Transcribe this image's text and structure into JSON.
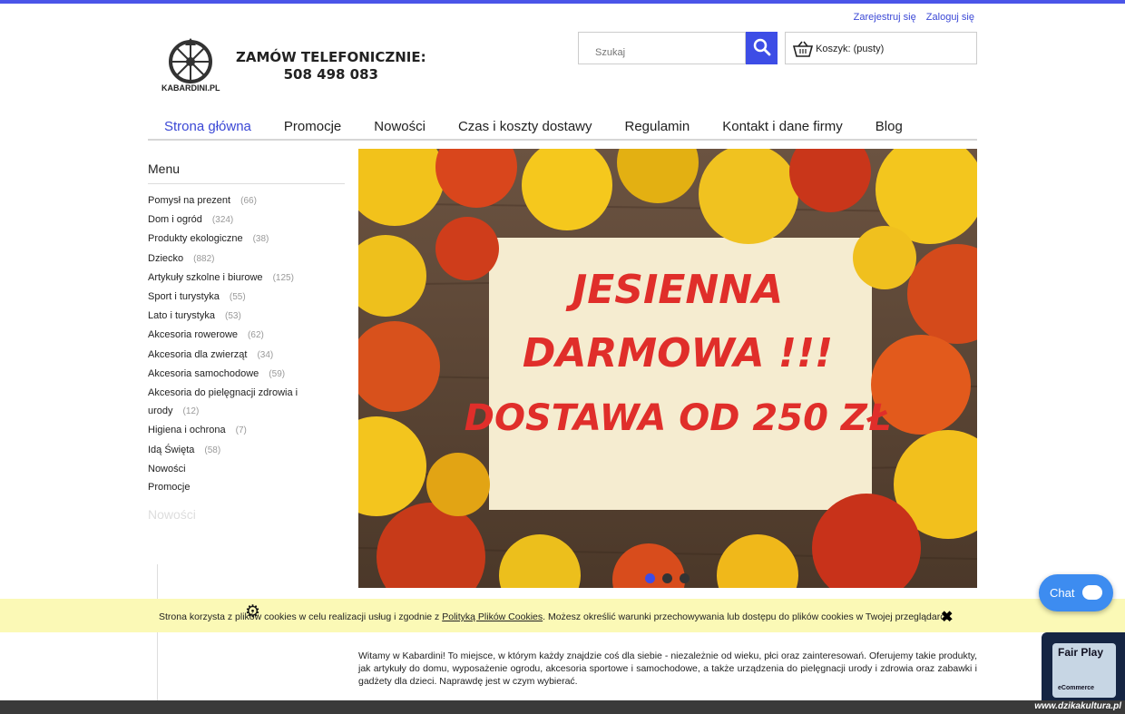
{
  "header": {
    "register_link": "Zarejestruj się",
    "login_link": "Zaloguj się",
    "logo_text": "KABARDINI.PL",
    "phone_label": "ZAMÓW TELEFONICZNIE:",
    "phone_number": "508 498 083",
    "search_placeholder": "Szukaj",
    "cart_label": "Koszyk: (pusty)",
    "accent_color": "#3d4de6"
  },
  "nav": {
    "items": [
      {
        "label": "Strona główna",
        "active": true
      },
      {
        "label": "Promocje"
      },
      {
        "label": "Nowości"
      },
      {
        "label": "Czas i koszty dostawy"
      },
      {
        "label": "Regulamin"
      },
      {
        "label": "Kontakt i dane firmy"
      },
      {
        "label": "Blog"
      }
    ]
  },
  "sidebar": {
    "menu_title": "Menu",
    "items": [
      {
        "label": "Pomysł na prezent",
        "count": "(66)"
      },
      {
        "label": "Dom i ogród",
        "count": "(324)"
      },
      {
        "label": "Produkty ekologiczne",
        "count": "(38)"
      },
      {
        "label": "Dziecko",
        "count": "(882)"
      },
      {
        "label": "Artykuły szkolne i biurowe",
        "count": "(125)"
      },
      {
        "label": "Sport i turystyka",
        "count": "(55)"
      },
      {
        "label": "Lato i turystyka",
        "count": "(53)"
      },
      {
        "label": "Akcesoria rowerowe",
        "count": "(62)"
      },
      {
        "label": "Akcesoria dla zwierząt",
        "count": "(34)"
      },
      {
        "label": "Akcesoria samochodowe",
        "count": "(59)"
      },
      {
        "label": "Akcesoria do pielęgnacji zdrowia i",
        "count": ""
      },
      {
        "label": "urody",
        "count": "(12)"
      },
      {
        "label": "Higiena i ochrona",
        "count": "(7)"
      },
      {
        "label": "Idą Święta",
        "count": "(58)"
      },
      {
        "label": "Nowości",
        "count": ""
      },
      {
        "label": "Promocje",
        "count": ""
      }
    ],
    "new_title": "Nowości"
  },
  "banner": {
    "line1": "JESIENNA",
    "line2": "DARMOWA !!!",
    "line3": "DOSTAWA OD 250 ZŁ",
    "text_color": "#e02e2a",
    "slides": 3,
    "active_slide": 1
  },
  "cookie": {
    "text_before": "Strona korzysta z plików cookies w celu realizacji usług i zgodnie z ",
    "link": "Polityką Plików Cookies",
    "text_after": ". Możesz określić warunki przechowywania lub dostępu do plików cookies w Twojej przeglądarce.",
    "close_icon": "✖"
  },
  "intro": {
    "text": "Witamy w Kabardini! To miejsce, w którym każdy znajdzie coś dla siebie - niezależnie od wieku, płci oraz zainteresowań. Oferujemy takie produkty, jak artykuły do domu, wyposażenie ogrodu, akcesoria sportowe i samochodowe, a także urządzenia do pielęgnacji urody i zdrowia oraz zabawki i gadżety dla dzieci. Naprawdę jest w czym wybierać."
  },
  "widgets": {
    "chat_label": "Chat",
    "fairplay_title": "Fair Play",
    "fairplay_sub": "eCommerce",
    "watermark": "www.dzikakultura.pl"
  }
}
